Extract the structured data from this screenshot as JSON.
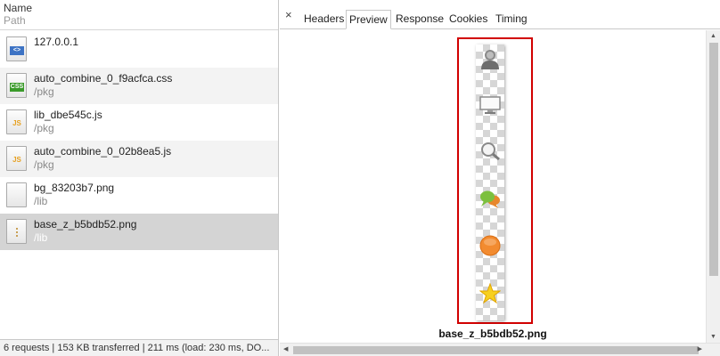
{
  "columns": {
    "name": "Name",
    "path": "Path"
  },
  "requests": [
    {
      "name": "127.0.0.1",
      "path": "",
      "icon": "html-file-icon",
      "tag": "<>"
    },
    {
      "name": "auto_combine_0_f9acfca.css",
      "path": "/pkg",
      "icon": "css-file-icon",
      "tag": "CSS"
    },
    {
      "name": "lib_dbe545c.js",
      "path": "/pkg",
      "icon": "js-file-icon",
      "tag": "JS"
    },
    {
      "name": "auto_combine_0_02b8ea5.js",
      "path": "/pkg",
      "icon": "js-file-icon",
      "tag": "JS"
    },
    {
      "name": "bg_83203b7.png",
      "path": "/lib",
      "icon": "image-file-icon",
      "tag": ""
    },
    {
      "name": "base_z_b5bdb52.png",
      "path": "/lib",
      "icon": "image-file-icon",
      "tag": ""
    }
  ],
  "status": "6 requests | 153 KB transferred | 211 ms (load: 230 ms, DO...",
  "tabs": {
    "close": "×",
    "headers": "Headers",
    "preview": "Preview",
    "response": "Response",
    "cookies": "Cookies",
    "timing": "Timing"
  },
  "preview": {
    "filename": "base_z_b5bdb52.png",
    "sprite_icons": [
      "user-icon",
      "monitor-icon",
      "magnifier-icon",
      "chat-bubbles-icon",
      "orange-circle-icon",
      "star-icon"
    ]
  },
  "colors": {
    "highlight": "#d10000",
    "selected_row": "#d4d4d4"
  }
}
